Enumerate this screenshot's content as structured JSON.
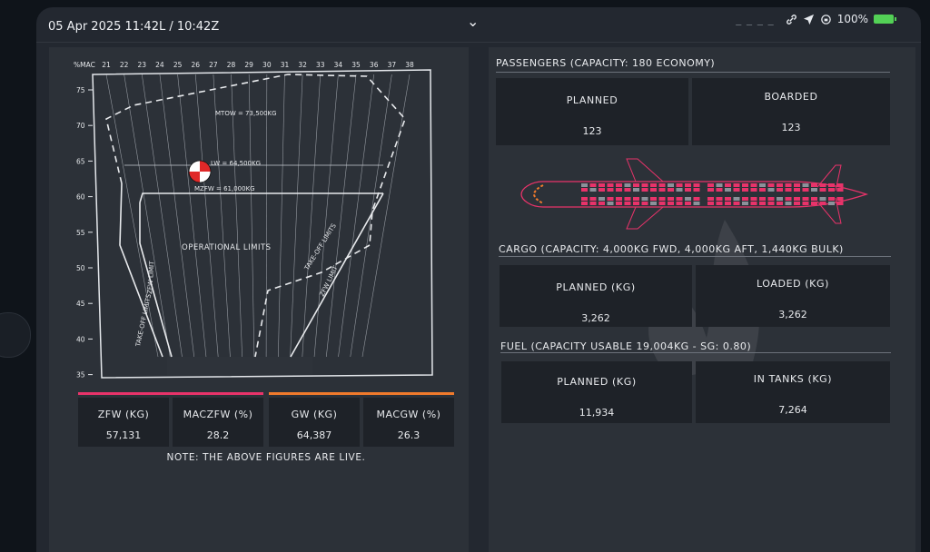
{
  "status": {
    "date_time": "05 Apr 2025   11:42L / 10:42Z",
    "chevron": "⌄",
    "dashes": "_ _ _ _",
    "battery": "100%"
  },
  "envelope": {
    "mac_label": "%MAC",
    "mac_ticks": [
      "21",
      "22",
      "23",
      "24",
      "25",
      "26",
      "27",
      "28",
      "29",
      "30",
      "31",
      "32",
      "33",
      "34",
      "35",
      "36",
      "37",
      "38"
    ],
    "weight_ticks": [
      "75",
      "70",
      "65",
      "60",
      "55",
      "50",
      "45",
      "40",
      "35"
    ],
    "labels": {
      "mtow": "MTOW = 73,500KG",
      "lw": "LW = 64,500KG",
      "mzfw": "MZFW = 61,000KG",
      "operational": "OPERATIONAL LIMITS",
      "zfw_limit_left": "ZFW LIMIT",
      "takeoff_limits_left": "TAKE-OFF LIMITS",
      "takeoff_limits_right": "TAKE-OFF LIMITS",
      "zfw_limit_right": "ZFW LIMIT"
    }
  },
  "summary": {
    "zfw_label": "ZFW (KG)",
    "zfw_value": "57,131",
    "maczfw_label": "MACZFW (%)",
    "maczfw_value": "28.2",
    "gw_label": "GW (KG)",
    "gw_value": "64,387",
    "macgw_label": "MACGW (%)",
    "macgw_value": "26.3",
    "note": "NOTE: THE ABOVE FIGURES ARE LIVE.",
    "colors": {
      "zfw": "#e8336a",
      "gw": "#f07a2c"
    }
  },
  "passengers": {
    "title": "PASSENGERS (CAPACITY: 180 ECONOMY)",
    "planned_label": "PLANNED",
    "planned_value": "123",
    "boarded_label": "BOARDED",
    "boarded_value": "123"
  },
  "cargo": {
    "title": "CARGO (CAPACITY: 4,000KG FWD, 4,000KG AFT, 1,440KG BULK)",
    "planned_label": "PLANNED (KG)",
    "planned_value": "3,262",
    "loaded_label": "LOADED (KG)",
    "loaded_value": "3,262"
  },
  "fuel": {
    "title": "FUEL (CAPACITY USABLE 19,004KG - SG: 0.80)",
    "planned_label": "PLANNED (KG)",
    "planned_value": "11,934",
    "tanks_label": "IN TANKS (KG)",
    "tanks_value": "7,264"
  }
}
